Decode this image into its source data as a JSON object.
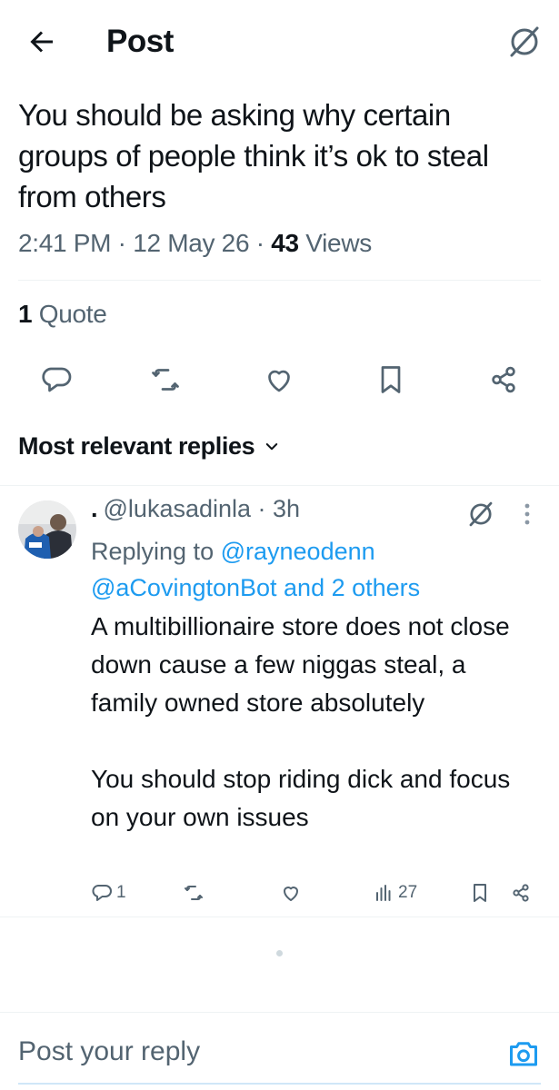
{
  "header": {
    "title": "Post",
    "back_icon": "arrow-left-icon",
    "grok_icon": "grok-icon"
  },
  "tweet": {
    "text": "You should be asking why certain groups of people think it’s ok to steal from others",
    "time": "2:41 PM",
    "date": "12 May 26",
    "views_count": "43",
    "views_label": "Views",
    "quotes_count": "1",
    "quotes_label": "Quote",
    "actions": [
      "reply-icon",
      "retweet-icon",
      "like-icon",
      "bookmark-icon",
      "share-icon"
    ]
  },
  "sort": {
    "label": "Most relevant replies"
  },
  "reply": {
    "display_name": ".",
    "handle": "@lukasadinla",
    "time": "3h",
    "replying_prefix": "Replying to",
    "replying_to_1": "@rayneodenn",
    "replying_to_2": "@aCovingtonBot and 2 others",
    "text": "A multibillionaire store does not close down cause a few niggas steal, a family owned store absolutely\n\nYou should stop riding dick and focus on your own issues",
    "reply_count": "1",
    "views_count": "27"
  },
  "composer": {
    "placeholder": "Post your reply"
  },
  "colors": {
    "text": "#0f1419",
    "secondary": "#536471",
    "link": "#1d9bf0",
    "divider": "#eff3f4"
  }
}
